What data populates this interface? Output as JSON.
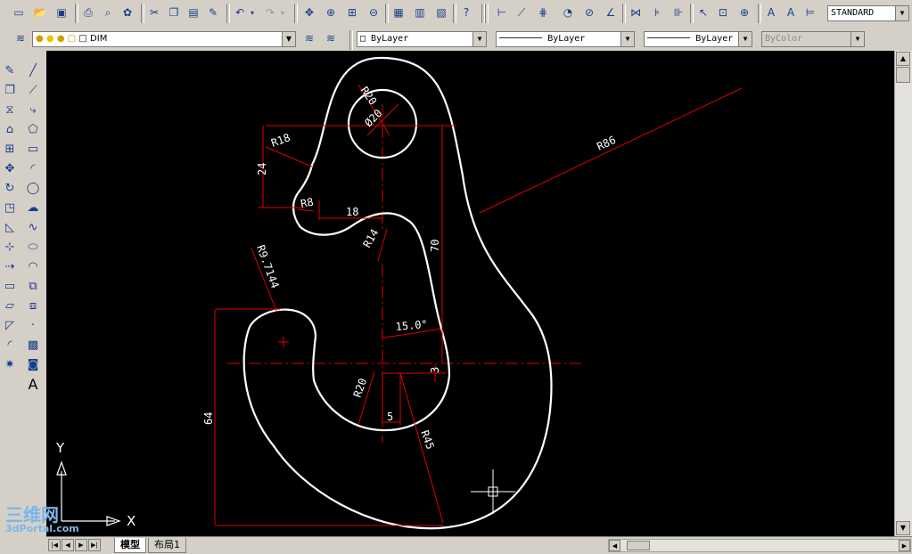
{
  "toolbar": {
    "text_style": "STANDARD",
    "layer": "DIM",
    "color": "ByLayer",
    "linetype": "ByLayer",
    "lineweight": "ByLayer",
    "plotstyle": "ByColor"
  },
  "drawing": {
    "dims": [
      "R20",
      "Ø20",
      "R18",
      "24",
      "R8",
      "18",
      "R14",
      "70",
      "R86",
      "R9.7144",
      "15.0°",
      "3",
      "R20",
      "5",
      "R45",
      "64"
    ],
    "ucs_x": "X",
    "ucs_y": "Y",
    "colors": {
      "geometry": "#ffffff",
      "dimension": "#e00000",
      "background": "#000000"
    }
  },
  "tabs": {
    "model": "模型",
    "layout1": "布局1"
  },
  "watermark": {
    "line1": "三维网",
    "line2": "3dPortal.com"
  }
}
